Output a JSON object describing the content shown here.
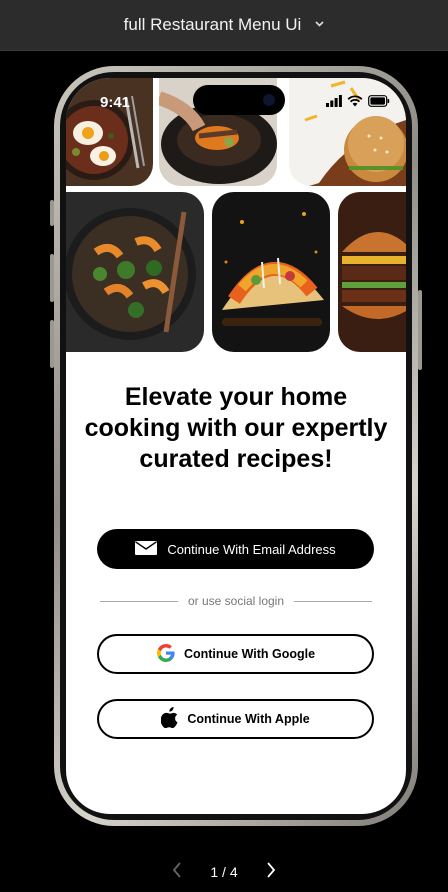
{
  "header": {
    "title": "full Restaurant Menu Ui"
  },
  "status_bar": {
    "time": "9:41"
  },
  "onboarding": {
    "headline_line1": "Elevate your home",
    "headline_line2": "cooking with our expertly",
    "headline_line3": "curated recipes!",
    "email_button": "Continue With Email Address",
    "divider_text": "or use social login",
    "google_button": "Continue With Google",
    "apple_button": "Continue With Apple"
  },
  "pager": {
    "current": "1 / 4"
  },
  "colors": {
    "accent": "#000000",
    "background": "#ffffff",
    "frame": "#2c2c2c"
  },
  "icons": [
    "chevron-down-icon",
    "signal-icon",
    "wifi-icon",
    "battery-icon",
    "mail-icon",
    "google-icon",
    "apple-icon",
    "chevron-left-icon",
    "chevron-right-icon"
  ]
}
